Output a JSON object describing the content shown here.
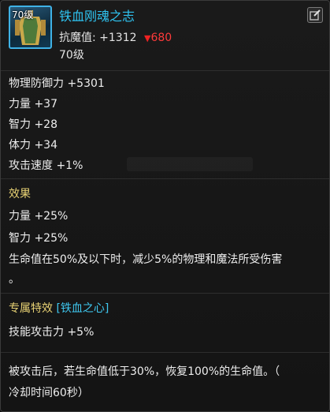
{
  "item": {
    "level_badge": "70级",
    "name": "铁血刚魂之志",
    "resist_label": "抗魔值:",
    "resist_bonus": "+1312",
    "resist_penalty": "680",
    "level": "70级",
    "icon": "armor-icon",
    "colors": {
      "name": "#2fc4f2",
      "penalty": "#ff3b3b",
      "section": "#e8d274"
    }
  },
  "stats": [
    "物理防御力 +5301",
    "力量 +37",
    "智力 +28",
    "体力 +34",
    "攻击速度 +1%"
  ],
  "effect": {
    "title": "效果",
    "lines": [
      "力量 +25%",
      "智力 +25%",
      "生命值在50%及以下时，减少5%的物理和魔法所受伤害",
      "。"
    ]
  },
  "special": {
    "title": "专属特效",
    "name": "[铁血之心]",
    "bonus": "技能攻击力 +5%",
    "desc_line1": "被攻击后，若生命值低于30%，恢复100%的生命值。（",
    "desc_line2": "冷却时间60秒）"
  }
}
